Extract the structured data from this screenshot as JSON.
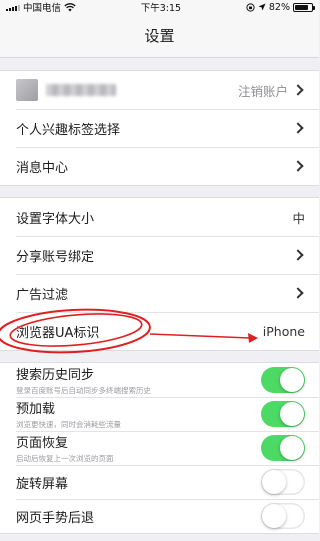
{
  "status_bar": {
    "carrier": "中国电信",
    "time": "下午3:15",
    "battery": "82%",
    "battery_level": 0.82
  },
  "nav": {
    "title": "设置"
  },
  "account": {
    "logout_label": "注销账户"
  },
  "group1": {
    "interest_tags": "个人兴趣标签选择",
    "message_center": "消息中心"
  },
  "group2": {
    "font_size_label": "设置字体大小",
    "font_size_value": "中",
    "share_binding": "分享账号绑定",
    "ad_filter": "广告过滤",
    "ua_label": "浏览器UA标识",
    "ua_value": "iPhone"
  },
  "group3": {
    "items": [
      {
        "label": "搜索历史同步",
        "sub": "登录百度账号后自动同步多终端搜索历史",
        "on": true
      },
      {
        "label": "预加载",
        "sub": "浏览更快速，同时会消耗些流量",
        "on": true
      },
      {
        "label": "页面恢复",
        "sub": "启动后恢复上一次浏览的页面",
        "on": true
      },
      {
        "label": "旋转屏幕",
        "sub": "",
        "on": false
      },
      {
        "label": "网页手势后退",
        "sub": "",
        "on": false
      }
    ]
  },
  "colors": {
    "toggle_on": "#4cd964",
    "annotation_red": "#e02020"
  }
}
